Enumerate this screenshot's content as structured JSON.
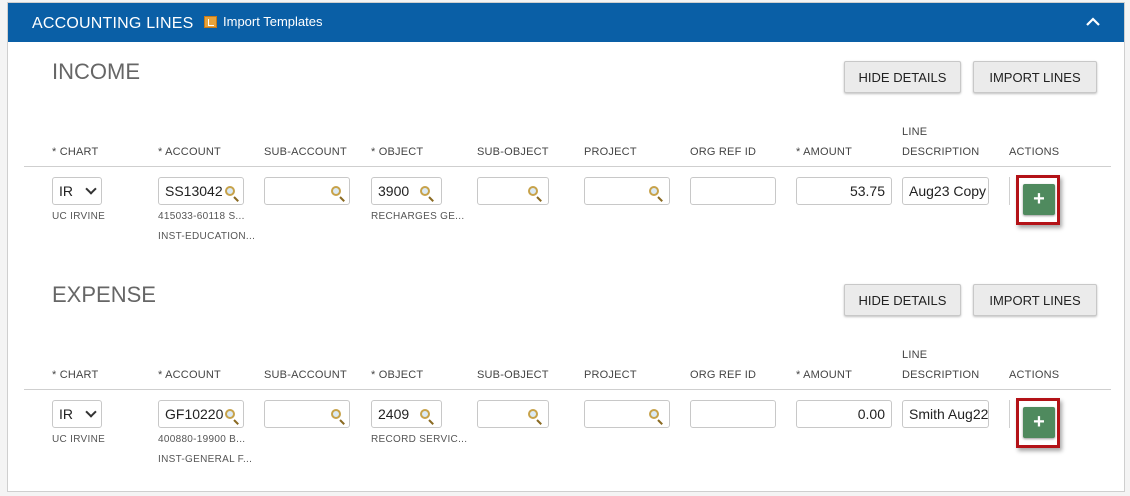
{
  "header": {
    "title": "ACCOUNTING LINES",
    "import_templates": "Import Templates"
  },
  "columns": {
    "chart": "* CHART",
    "account": "* ACCOUNT",
    "sub_account": "SUB-ACCOUNT",
    "object": "* OBJECT",
    "sub_object": "SUB-OBJECT",
    "project": "PROJECT",
    "org_ref_id": "ORG REF ID",
    "amount": "* AMOUNT",
    "line_desc_1": "LINE",
    "line_desc_2": "DESCRIPTION",
    "actions": "ACTIONS"
  },
  "income": {
    "title": "INCOME",
    "hide_details": "HIDE DETAILS",
    "import_lines": "IMPORT LINES",
    "row": {
      "chart": "IR",
      "chart_desc": "UC IRVINE",
      "account": "SS13042",
      "account_desc_1": "415033-60118 S...",
      "account_desc_2": "INST-EDUCATION...",
      "sub_account": "",
      "object": "3900",
      "object_desc": "RECHARGES GE...",
      "sub_object": "",
      "project": "",
      "org_ref_id": "",
      "amount": "53.75",
      "description": "Aug23 Copy",
      "add": "+"
    }
  },
  "expense": {
    "title": "EXPENSE",
    "hide_details": "HIDE DETAILS",
    "import_lines": "IMPORT LINES",
    "row": {
      "chart": "IR",
      "chart_desc": "UC IRVINE",
      "account": "GF10220",
      "account_desc_1": "400880-19900 B...",
      "account_desc_2": "INST-GENERAL F...",
      "sub_account": "",
      "object": "2409",
      "object_desc": "RECORD SERVIC...",
      "sub_object": "",
      "project": "",
      "org_ref_id": "",
      "amount": "0.00",
      "description": "Smith Aug22",
      "add": "+"
    }
  }
}
